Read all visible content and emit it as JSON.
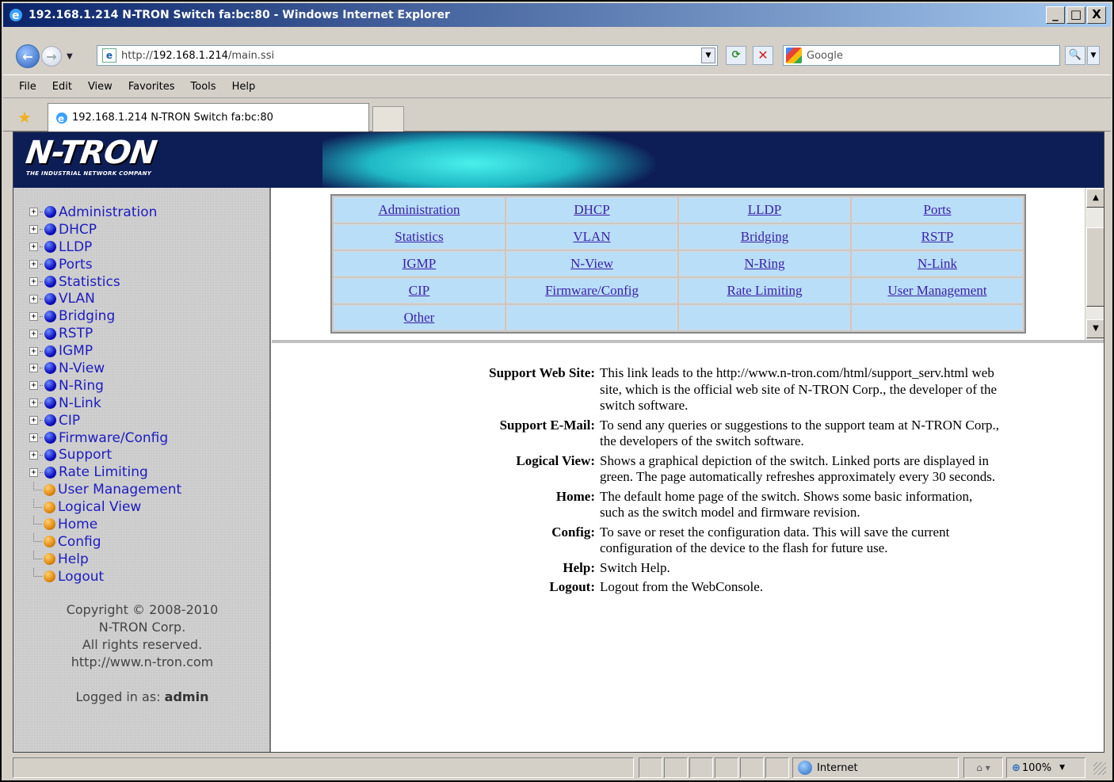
{
  "window": {
    "title": "192.168.1.214 N-TRON Switch fa:bc:80 - Windows Internet Explorer",
    "buttons": {
      "minimize": "_",
      "maximize": "□",
      "close": "X"
    }
  },
  "address": {
    "url_prefix": "http://",
    "url_host": "192.168.1.214",
    "url_path": "/main.ssi"
  },
  "search": {
    "placeholder": "Google"
  },
  "menu": [
    "File",
    "Edit",
    "View",
    "Favorites",
    "Tools",
    "Help"
  ],
  "tab": {
    "label": "192.168.1.214 N-TRON Switch fa:bc:80"
  },
  "banner": {
    "logo": "N-TRON",
    "tagline": "THE INDUSTRIAL NETWORK COMPANY"
  },
  "sidebar": {
    "items": [
      {
        "label": "Administration",
        "kind": "folder"
      },
      {
        "label": "DHCP",
        "kind": "folder"
      },
      {
        "label": "LLDP",
        "kind": "folder"
      },
      {
        "label": "Ports",
        "kind": "folder"
      },
      {
        "label": "Statistics",
        "kind": "folder"
      },
      {
        "label": "VLAN",
        "kind": "folder"
      },
      {
        "label": "Bridging",
        "kind": "folder"
      },
      {
        "label": "RSTP",
        "kind": "folder"
      },
      {
        "label": "IGMP",
        "kind": "folder"
      },
      {
        "label": "N-View",
        "kind": "folder"
      },
      {
        "label": "N-Ring",
        "kind": "folder"
      },
      {
        "label": "N-Link",
        "kind": "folder"
      },
      {
        "label": "CIP",
        "kind": "folder"
      },
      {
        "label": "Firmware/Config",
        "kind": "folder"
      },
      {
        "label": "Support",
        "kind": "folder"
      },
      {
        "label": "Rate Limiting",
        "kind": "folder"
      },
      {
        "label": "User Management",
        "kind": "page"
      },
      {
        "label": "Logical View",
        "kind": "page"
      },
      {
        "label": "Home",
        "kind": "page"
      },
      {
        "label": "Config",
        "kind": "page"
      },
      {
        "label": "Help",
        "kind": "page"
      },
      {
        "label": "Logout",
        "kind": "page"
      }
    ],
    "footer": {
      "copyright": "Copyright © 2008-2010",
      "company": "N-TRON Corp.",
      "rights": "All rights reserved.",
      "url": "http://www.n-tron.com",
      "logged_in_prefix": "Logged in as:",
      "username": "admin"
    }
  },
  "nav_table": [
    [
      "Administration",
      "DHCP",
      "LLDP",
      "Ports"
    ],
    [
      "Statistics",
      "VLAN",
      "Bridging",
      "RSTP"
    ],
    [
      "IGMP",
      "N-View",
      "N-Ring",
      "N-Link"
    ],
    [
      "CIP",
      "Firmware/Config",
      "Rate Limiting",
      "User Management"
    ],
    [
      "Other",
      "",
      "",
      ""
    ]
  ],
  "help": [
    {
      "term": "Support Web Site:",
      "desc": "This link leads to the http://www.n-tron.com/html/support_serv.html web site, which is the official web site of N-TRON Corp., the developer of the switch software."
    },
    {
      "term": "Support E-Mail:",
      "desc": "To send any queries or suggestions to the support team at N-TRON Corp., the developers of the switch software."
    },
    {
      "term": "Logical View:",
      "desc": "Shows a graphical depiction of the switch. Linked ports are displayed in green. The page automatically refreshes approximately every 30 seconds."
    },
    {
      "term": "Home:",
      "desc": "The default home page of the switch. Shows some basic information, such as the switch model and firmware revision."
    },
    {
      "term": "Config:",
      "desc": "To save or reset the configuration data. This will save the current configuration of the device to the flash for future use."
    },
    {
      "term": "Help:",
      "desc": "Switch Help."
    },
    {
      "term": "Logout:",
      "desc": "Logout from the WebConsole."
    }
  ],
  "status": {
    "zone": "Internet",
    "zoom": "100%"
  },
  "colors": {
    "titlebar": "#0a246a",
    "banner": "#0d1e56",
    "nav_cell": "#b9def8",
    "link": "#3a1fa8",
    "tree_link": "#1c1cc0"
  }
}
